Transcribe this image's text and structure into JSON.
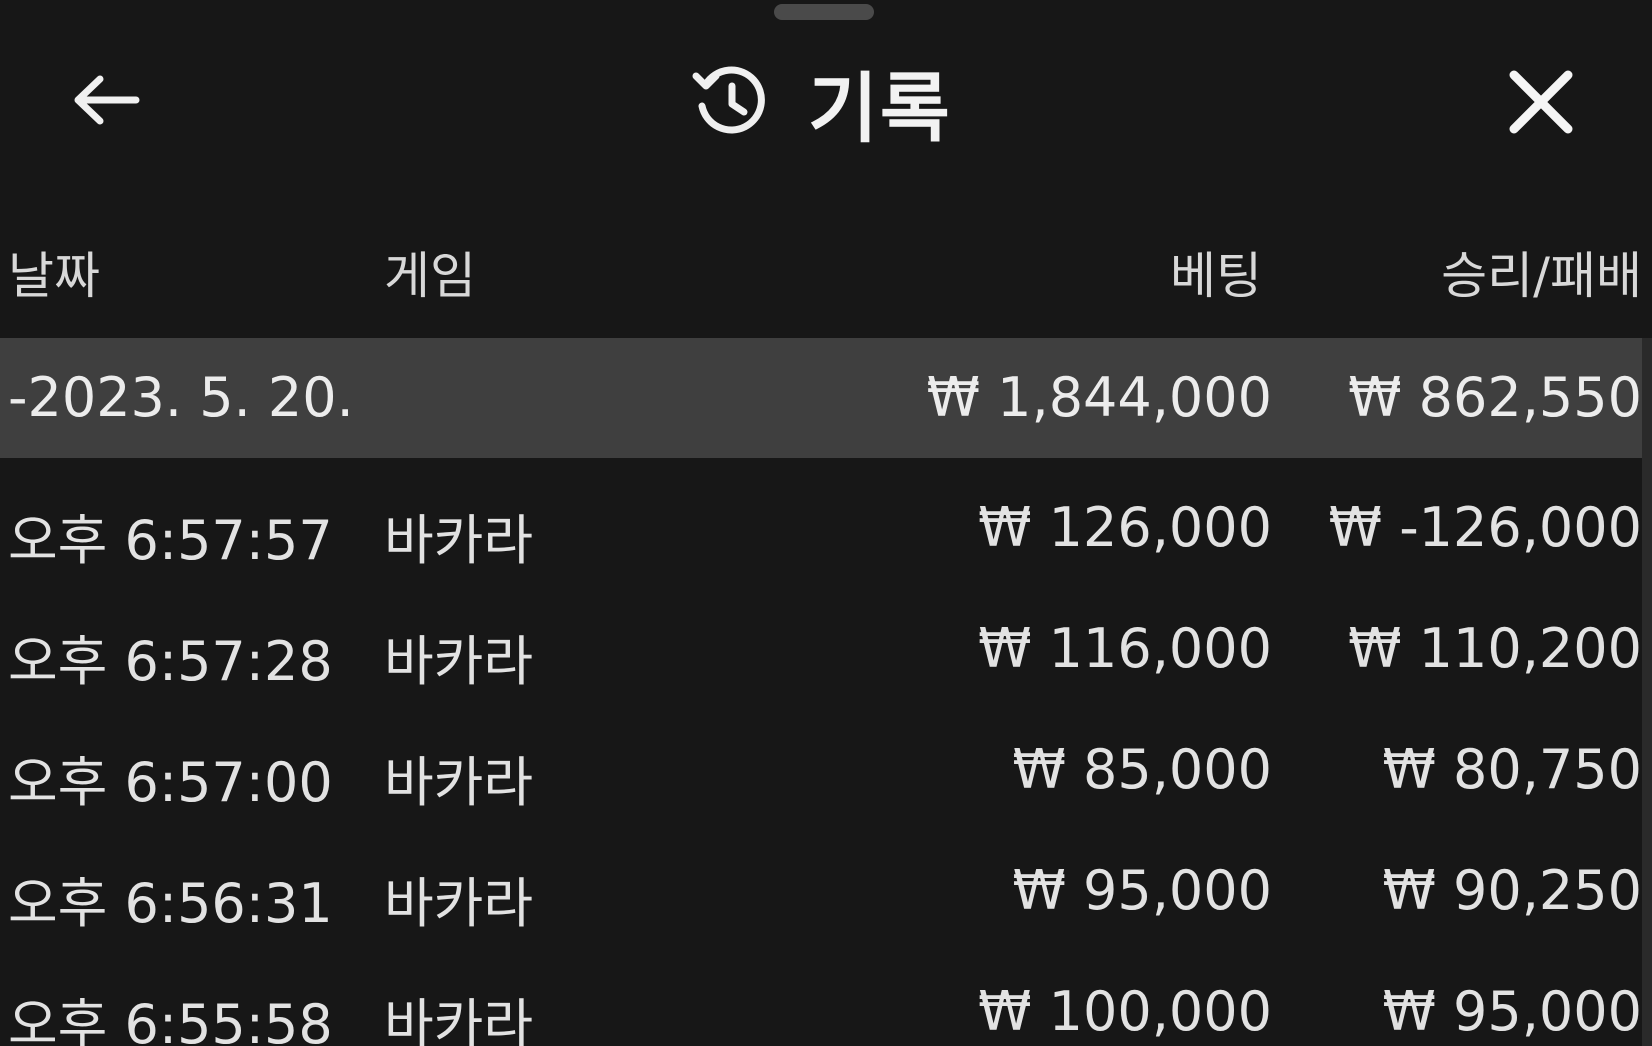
{
  "header": {
    "title": "기록",
    "back_icon": "arrow-left-icon",
    "history_icon": "history-clock-icon",
    "close_icon": "close-icon"
  },
  "columns": {
    "date": "날짜",
    "game": "게임",
    "bet": "베팅",
    "result": "승리/패배"
  },
  "date_group": {
    "date": "-2023. 5. 20.",
    "bet_total": "₩ 1,844,000",
    "result_total": "₩ 862,550"
  },
  "rows": [
    {
      "time": "오후 6:57:57",
      "game": "바카라",
      "bet": "₩ 126,000",
      "result": "₩ -126,000"
    },
    {
      "time": "오후 6:57:28",
      "game": "바카라",
      "bet": "₩ 116,000",
      "result": "₩ 110,200"
    },
    {
      "time": "오후 6:57:00",
      "game": "바카라",
      "bet": "₩ 85,000",
      "result": "₩ 80,750"
    },
    {
      "time": "오후 6:56:31",
      "game": "바카라",
      "bet": "₩ 95,000",
      "result": "₩ 90,250"
    },
    {
      "time": "오후 6:55:58",
      "game": "바카라",
      "bet": "₩ 100,000",
      "result": "₩ 95,000"
    }
  ],
  "colors": {
    "background": "#171717",
    "date_row_background": "#3f3f3f",
    "text": "#e6e6e6"
  }
}
